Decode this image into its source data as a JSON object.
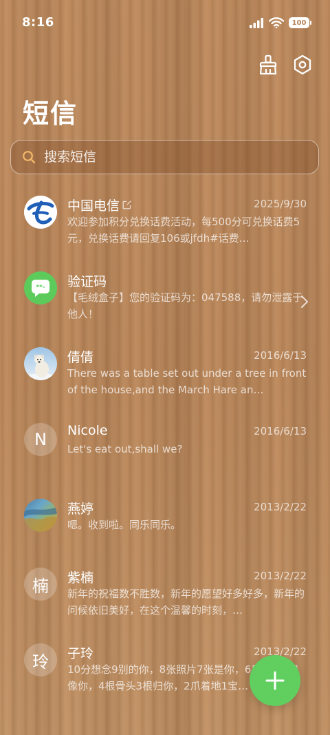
{
  "status": {
    "time": "8:16",
    "battery": "100"
  },
  "header": {
    "title": "短信"
  },
  "search": {
    "placeholder": "搜索短信"
  },
  "conversations": [
    {
      "name": "中国电信",
      "date": "2025/9/30",
      "snippet": "欢迎参加积分兑换话费活动，每500分可兑换话费5元，兑换话费请回复106或jfdh#话费…"
    },
    {
      "name": "验证码",
      "date": "",
      "snippet": "【毛绒盒子】您的验证码为：047588，请勿泄露于他人！"
    },
    {
      "name": "倩倩",
      "date": "2016/6/13",
      "snippet": "There was a table set out under a tree in front of the house,and the March Hare an…"
    },
    {
      "name": "Nicole",
      "date": "2016/6/13",
      "snippet": "Let's eat out,shall we?",
      "avatar_letter": "N"
    },
    {
      "name": "燕婷",
      "date": "2013/2/22",
      "snippet": "嗯。收到啦。同乐同乐。"
    },
    {
      "name": "紫楠",
      "date": "2013/2/22",
      "snippet": "新年的祝福数不胜数，新年的愿望好多好多，新年的问候依旧美好，在这个温馨的时刻，…",
      "avatar_letter": "楠"
    },
    {
      "name": "子玲",
      "date": "2013/2/22",
      "snippet": "10分想念9别的你，8张照片7张是你，6只小狗5只像你，4根骨头3根归你，2爪着地1宝…",
      "avatar_letter": "玲"
    }
  ],
  "colors": {
    "fab": "#60cf5f",
    "sms_icon_bg": "#5dcb5c",
    "telecom_blue": "#1f5fb8"
  },
  "icons": {
    "brush": "brush-clean-icon",
    "settings": "settings-hexagon-icon",
    "search": "search-icon",
    "add": "plus-icon",
    "chevron": "chevron-right-icon",
    "external": "external-link-icon"
  }
}
